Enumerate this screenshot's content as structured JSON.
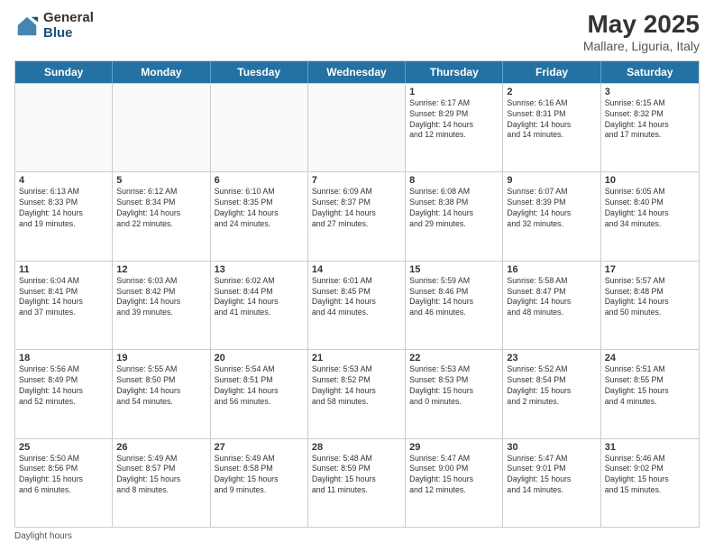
{
  "logo": {
    "general": "General",
    "blue": "Blue"
  },
  "title": {
    "month": "May 2025",
    "location": "Mallare, Liguria, Italy"
  },
  "headers": [
    "Sunday",
    "Monday",
    "Tuesday",
    "Wednesday",
    "Thursday",
    "Friday",
    "Saturday"
  ],
  "weeks": [
    [
      {
        "day": "",
        "info": ""
      },
      {
        "day": "",
        "info": ""
      },
      {
        "day": "",
        "info": ""
      },
      {
        "day": "",
        "info": ""
      },
      {
        "day": "1",
        "info": "Sunrise: 6:17 AM\nSunset: 8:29 PM\nDaylight: 14 hours\nand 12 minutes."
      },
      {
        "day": "2",
        "info": "Sunrise: 6:16 AM\nSunset: 8:31 PM\nDaylight: 14 hours\nand 14 minutes."
      },
      {
        "day": "3",
        "info": "Sunrise: 6:15 AM\nSunset: 8:32 PM\nDaylight: 14 hours\nand 17 minutes."
      }
    ],
    [
      {
        "day": "4",
        "info": "Sunrise: 6:13 AM\nSunset: 8:33 PM\nDaylight: 14 hours\nand 19 minutes."
      },
      {
        "day": "5",
        "info": "Sunrise: 6:12 AM\nSunset: 8:34 PM\nDaylight: 14 hours\nand 22 minutes."
      },
      {
        "day": "6",
        "info": "Sunrise: 6:10 AM\nSunset: 8:35 PM\nDaylight: 14 hours\nand 24 minutes."
      },
      {
        "day": "7",
        "info": "Sunrise: 6:09 AM\nSunset: 8:37 PM\nDaylight: 14 hours\nand 27 minutes."
      },
      {
        "day": "8",
        "info": "Sunrise: 6:08 AM\nSunset: 8:38 PM\nDaylight: 14 hours\nand 29 minutes."
      },
      {
        "day": "9",
        "info": "Sunrise: 6:07 AM\nSunset: 8:39 PM\nDaylight: 14 hours\nand 32 minutes."
      },
      {
        "day": "10",
        "info": "Sunrise: 6:05 AM\nSunset: 8:40 PM\nDaylight: 14 hours\nand 34 minutes."
      }
    ],
    [
      {
        "day": "11",
        "info": "Sunrise: 6:04 AM\nSunset: 8:41 PM\nDaylight: 14 hours\nand 37 minutes."
      },
      {
        "day": "12",
        "info": "Sunrise: 6:03 AM\nSunset: 8:42 PM\nDaylight: 14 hours\nand 39 minutes."
      },
      {
        "day": "13",
        "info": "Sunrise: 6:02 AM\nSunset: 8:44 PM\nDaylight: 14 hours\nand 41 minutes."
      },
      {
        "day": "14",
        "info": "Sunrise: 6:01 AM\nSunset: 8:45 PM\nDaylight: 14 hours\nand 44 minutes."
      },
      {
        "day": "15",
        "info": "Sunrise: 5:59 AM\nSunset: 8:46 PM\nDaylight: 14 hours\nand 46 minutes."
      },
      {
        "day": "16",
        "info": "Sunrise: 5:58 AM\nSunset: 8:47 PM\nDaylight: 14 hours\nand 48 minutes."
      },
      {
        "day": "17",
        "info": "Sunrise: 5:57 AM\nSunset: 8:48 PM\nDaylight: 14 hours\nand 50 minutes."
      }
    ],
    [
      {
        "day": "18",
        "info": "Sunrise: 5:56 AM\nSunset: 8:49 PM\nDaylight: 14 hours\nand 52 minutes."
      },
      {
        "day": "19",
        "info": "Sunrise: 5:55 AM\nSunset: 8:50 PM\nDaylight: 14 hours\nand 54 minutes."
      },
      {
        "day": "20",
        "info": "Sunrise: 5:54 AM\nSunset: 8:51 PM\nDaylight: 14 hours\nand 56 minutes."
      },
      {
        "day": "21",
        "info": "Sunrise: 5:53 AM\nSunset: 8:52 PM\nDaylight: 14 hours\nand 58 minutes."
      },
      {
        "day": "22",
        "info": "Sunrise: 5:53 AM\nSunset: 8:53 PM\nDaylight: 15 hours\nand 0 minutes."
      },
      {
        "day": "23",
        "info": "Sunrise: 5:52 AM\nSunset: 8:54 PM\nDaylight: 15 hours\nand 2 minutes."
      },
      {
        "day": "24",
        "info": "Sunrise: 5:51 AM\nSunset: 8:55 PM\nDaylight: 15 hours\nand 4 minutes."
      }
    ],
    [
      {
        "day": "25",
        "info": "Sunrise: 5:50 AM\nSunset: 8:56 PM\nDaylight: 15 hours\nand 6 minutes."
      },
      {
        "day": "26",
        "info": "Sunrise: 5:49 AM\nSunset: 8:57 PM\nDaylight: 15 hours\nand 8 minutes."
      },
      {
        "day": "27",
        "info": "Sunrise: 5:49 AM\nSunset: 8:58 PM\nDaylight: 15 hours\nand 9 minutes."
      },
      {
        "day": "28",
        "info": "Sunrise: 5:48 AM\nSunset: 8:59 PM\nDaylight: 15 hours\nand 11 minutes."
      },
      {
        "day": "29",
        "info": "Sunrise: 5:47 AM\nSunset: 9:00 PM\nDaylight: 15 hours\nand 12 minutes."
      },
      {
        "day": "30",
        "info": "Sunrise: 5:47 AM\nSunset: 9:01 PM\nDaylight: 15 hours\nand 14 minutes."
      },
      {
        "day": "31",
        "info": "Sunrise: 5:46 AM\nSunset: 9:02 PM\nDaylight: 15 hours\nand 15 minutes."
      }
    ]
  ],
  "footer": "Daylight hours"
}
